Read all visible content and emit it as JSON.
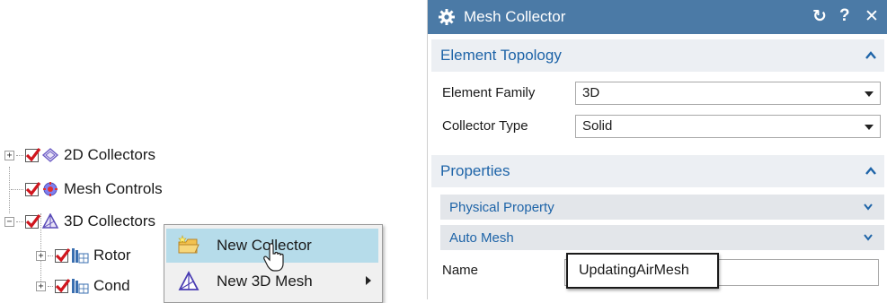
{
  "tree": {
    "items": [
      {
        "label": "2D Collectors"
      },
      {
        "label": "Mesh Controls"
      },
      {
        "label": "3D Collectors"
      },
      {
        "label": "Rotor"
      },
      {
        "label": "Cond"
      }
    ]
  },
  "context_menu": {
    "items": [
      {
        "label": "New Collector",
        "icon": "new-collector-icon"
      },
      {
        "label": "New 3D Mesh",
        "icon": "mesh-3d-icon"
      }
    ]
  },
  "dialog": {
    "title": "Mesh Collector",
    "reset_symbol": "↻",
    "help_symbol": "?",
    "close_symbol": "✕",
    "element_topology": {
      "title": "Element Topology",
      "element_family_label": "Element Family",
      "element_family_value": "3D",
      "collector_type_label": "Collector Type",
      "collector_type_value": "Solid"
    },
    "properties": {
      "title": "Properties",
      "physical_property_label": "Physical Property",
      "auto_mesh_label": "Auto Mesh",
      "name_label": "Name",
      "name_value": "UpdatingAirMesh"
    }
  },
  "colors": {
    "titlebar": "#4b7aa6",
    "section_header_text": "#1e64a8",
    "menu_highlight": "#b6dcea",
    "checkmark": "#d0161e"
  }
}
